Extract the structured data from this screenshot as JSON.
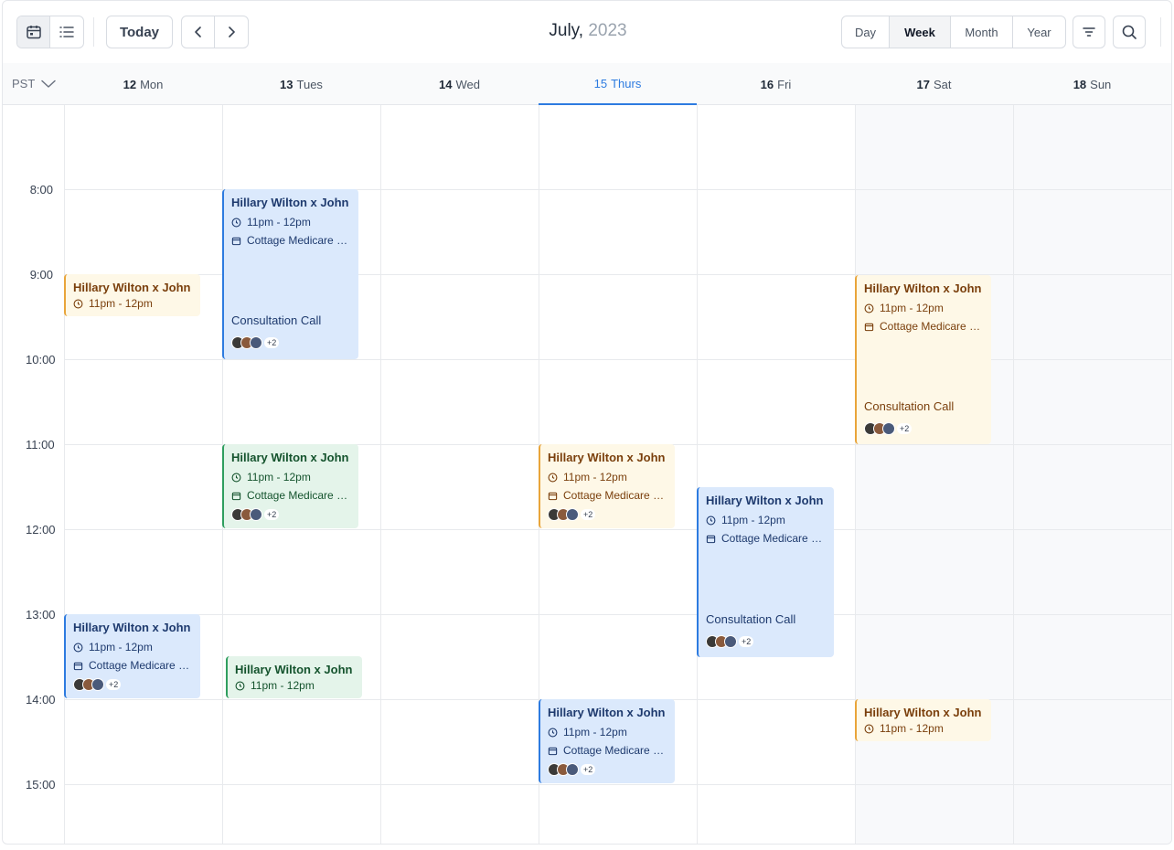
{
  "toolbar": {
    "today_label": "Today",
    "month": "July,",
    "year": " 2023",
    "ranges": [
      "Day",
      "Week",
      "Month",
      "Year"
    ],
    "active_range": "Week"
  },
  "header": {
    "timezone": "PST",
    "days": [
      {
        "num": "12",
        "name": "Mon"
      },
      {
        "num": "13",
        "name": "Tues"
      },
      {
        "num": "14",
        "name": "Wed"
      },
      {
        "num": "15",
        "name": "Thurs"
      },
      {
        "num": "16",
        "name": "Fri"
      },
      {
        "num": "17",
        "name": "Sat"
      },
      {
        "num": "18",
        "name": "Sun"
      }
    ]
  },
  "times": [
    "8:00",
    "9:00",
    "10:00",
    "11:00",
    "12:00",
    "13:00",
    "14:00",
    "15:00"
  ],
  "events": [
    {
      "title": "Hillary Wilton x John",
      "time": "11pm - 12pm",
      "location": "Cottage Medicare H...",
      "desc": "Consultation Call",
      "more": "+2"
    },
    {
      "title": "Hillary Wilton x John",
      "time": "11pm - 12pm"
    },
    {
      "title": "Hillary Wilton x John",
      "time": "11pm - 12pm",
      "location": "Cottage Medicare H...",
      "desc": "Consultation Call",
      "more": "+2"
    },
    {
      "title": "Hillary Wilton x John",
      "time": "11pm - 12pm",
      "location": "Cottage Medicare H...",
      "more": "+2"
    },
    {
      "title": "Hillary Wilton x John",
      "time": "11pm - 12pm",
      "location": "Cottage Medicare H...",
      "more": "+2"
    },
    {
      "title": "Hillary Wilton x John",
      "time": "11pm - 12pm",
      "location": "Cottage Medicare H...",
      "desc": "Consultation Call",
      "more": "+2"
    },
    {
      "title": "Hillary Wilton x John",
      "time": "11pm - 12pm",
      "location": "Cottage Medicare H...",
      "more": "+2"
    },
    {
      "title": "Hillary Wilton x John",
      "time": "11pm - 12pm"
    },
    {
      "title": "Hillary Wilton x John",
      "time": "11pm - 12pm",
      "location": "Cottage Medicare H...",
      "more": "+2"
    },
    {
      "title": "Hillary Wilton x John",
      "time": "11pm - 12pm"
    }
  ],
  "colors": {
    "today": "#2d7be0",
    "blue": "#dbe9fc",
    "yellow": "#fef8e7",
    "green": "#e4f4ea"
  }
}
